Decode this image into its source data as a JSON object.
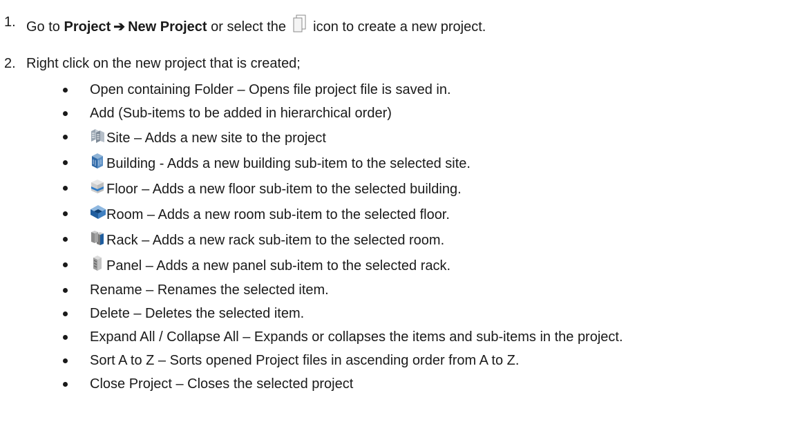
{
  "step1": {
    "number": "1.",
    "prefix": "Go to ",
    "menu_path_a": "Project",
    "arrow": "➔",
    "menu_path_b": "New Project",
    "middle": " or select the ",
    "icon": "new-project-icon",
    "suffix": " icon to create a new project."
  },
  "step2": {
    "number": "2.",
    "text": "Right click on the new project that is created;"
  },
  "items": [
    {
      "text": "Open containing Folder – Opens file project file is saved in."
    },
    {
      "text": "Add (Sub-items to be added in hierarchical order)"
    },
    {
      "icon": "site-icon",
      "text": "Site – Adds a new site to the project"
    },
    {
      "icon": "building-icon",
      "text": "Building - Adds a new building sub-item to the selected site."
    },
    {
      "icon": "floor-icon",
      "text": "Floor – Adds a new floor sub-item to the selected building."
    },
    {
      "icon": "room-icon",
      "text": "Room – Adds a new room sub-item to the selected floor."
    },
    {
      "icon": "rack-icon",
      "text": "Rack – Adds a new rack sub-item to the selected room."
    },
    {
      "icon": "panel-icon",
      "text": "Panel – Adds a new panel sub-item to the selected rack."
    },
    {
      "text": "Rename – Renames the selected item."
    },
    {
      "text": "Delete – Deletes the selected item."
    },
    {
      "text": "Expand All / Collapse All – Expands or collapses the items and sub-items in the project."
    },
    {
      "text": "Sort A to Z – Sorts opened Project files in ascending order from A to Z."
    },
    {
      "text": "Close Project – Closes the selected project"
    }
  ]
}
